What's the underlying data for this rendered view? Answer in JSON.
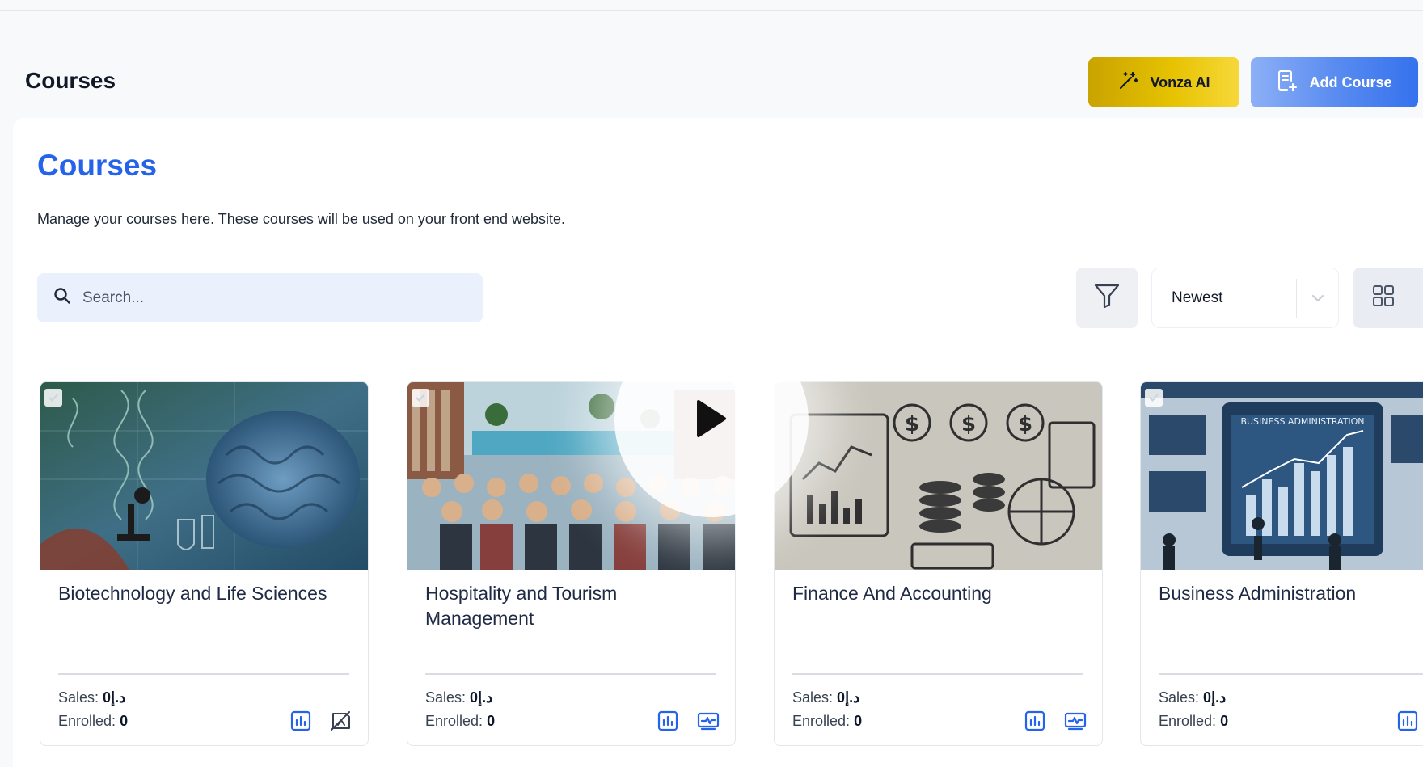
{
  "header": {
    "page_title": "Courses",
    "ai_button_label": "Vonza AI",
    "add_button_label": "Add Course"
  },
  "section": {
    "title": "Courses",
    "description": "Manage your courses here. These courses will be used on your front end website."
  },
  "toolbar": {
    "search_placeholder": "Search...",
    "sort_selected": "Newest"
  },
  "courses": [
    {
      "title": "Biotechnology and Life Sciences",
      "sales_label": "Sales:",
      "sales_value": "0د.إ",
      "enrolled_label": "Enrolled:",
      "enrolled_value": "0"
    },
    {
      "title": "Hospitality and Tourism Management",
      "sales_label": "Sales:",
      "sales_value": "0د.إ",
      "enrolled_label": "Enrolled:",
      "enrolled_value": "0"
    },
    {
      "title": "Finance And Accounting",
      "sales_label": "Sales:",
      "sales_value": "0د.إ",
      "enrolled_label": "Enrolled:",
      "enrolled_value": "0"
    },
    {
      "title": "Business Administration",
      "sales_label": "Sales:",
      "sales_value": "0د.إ",
      "enrolled_label": "Enrolled:",
      "enrolled_value": "0"
    }
  ],
  "thumbnail_text": {
    "business_admin_banner": "BUSINESS ADMINISTRATION"
  },
  "colors": {
    "primary": "#2563eb",
    "ai_yellow": "#e6c200",
    "icon_blue": "#2563eb"
  }
}
